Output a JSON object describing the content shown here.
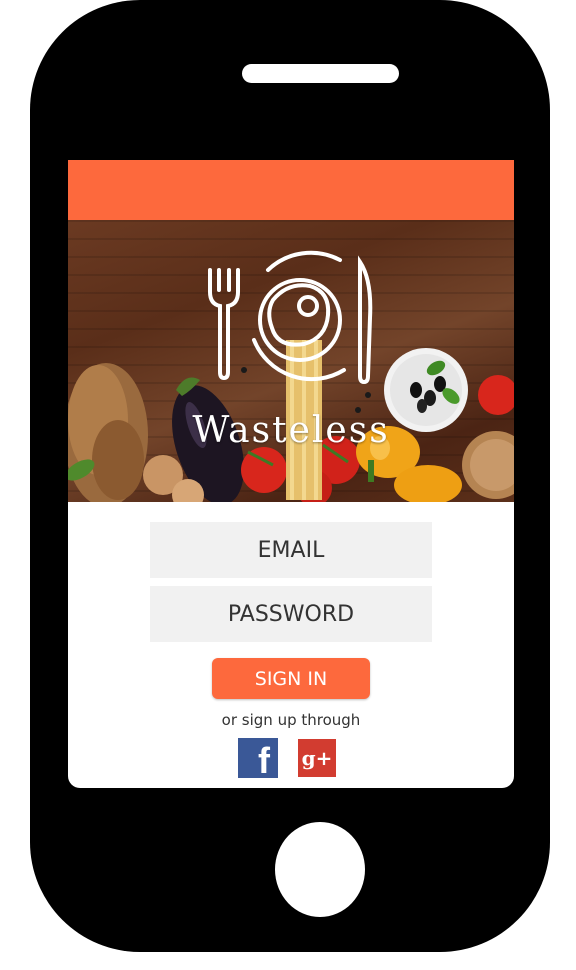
{
  "app": {
    "name": "Wasteless"
  },
  "login": {
    "email_placeholder": "EMAIL",
    "password_placeholder": "PASSWORD",
    "sign_in_label": "SIGN IN",
    "signup_text": "or sign up through"
  },
  "social": {
    "facebook_glyph": "f",
    "google_plus_glyph": "g+",
    "facebook_icon": "facebook-icon",
    "google_plus_icon": "google-plus-icon"
  },
  "colors": {
    "accent": "#fd693d",
    "facebook": "#3a5897",
    "google_plus": "#d23c30",
    "field_background": "#f1f1f1",
    "phone_body": "#000000"
  }
}
